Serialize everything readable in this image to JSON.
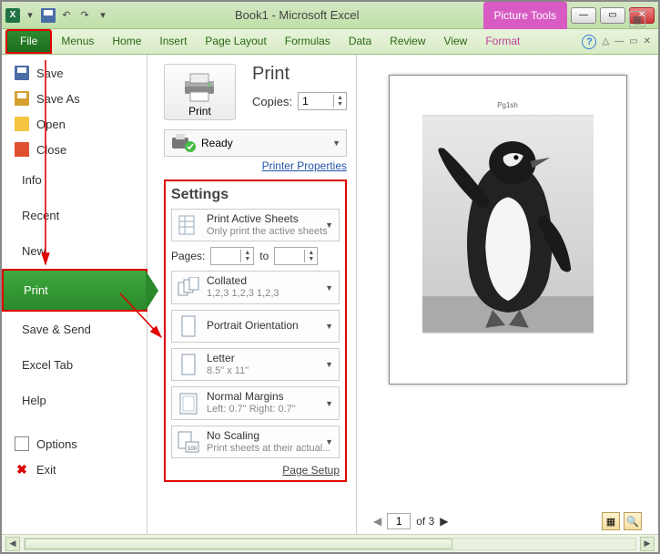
{
  "title": "Book1  -  Microsoft Excel",
  "picture_tools": "Picture Tools",
  "ribbon": {
    "file": "File",
    "tabs": [
      "Menus",
      "Home",
      "Insert",
      "Page Layout",
      "Formulas",
      "Data",
      "Review",
      "View"
    ],
    "format": "Format"
  },
  "sidebar": {
    "save": "Save",
    "save_as": "Save As",
    "open": "Open",
    "close": "Close",
    "info": "Info",
    "recent": "Recent",
    "new": "New",
    "print": "Print",
    "save_send": "Save & Send",
    "excel_tab": "Excel Tab",
    "help": "Help",
    "options": "Options",
    "exit": "Exit"
  },
  "print_panel": {
    "button": "Print",
    "heading": "Print",
    "copies_label": "Copies:",
    "copies_value": "1",
    "printer_status": "Ready",
    "printer_props": "Printer Properties",
    "settings_title": "Settings",
    "active_sheets": {
      "title": "Print Active Sheets",
      "sub": "Only print the active sheets"
    },
    "pages_label": "Pages:",
    "pages_to": "to",
    "collated": {
      "title": "Collated",
      "sub": "1,2,3    1,2,3    1,2,3"
    },
    "orientation": "Portrait Orientation",
    "paper": {
      "title": "Letter",
      "sub": "8.5\" x 11\""
    },
    "margins": {
      "title": "Normal Margins",
      "sub": "Left:  0.7\"    Right:  0.7\""
    },
    "scaling": {
      "title": "No Scaling",
      "sub": "Print sheets at their actual..."
    },
    "page_setup": "Page Setup"
  },
  "preview": {
    "page_label": "Pg1sh",
    "current_page": "1",
    "total_pages": "of 3"
  }
}
